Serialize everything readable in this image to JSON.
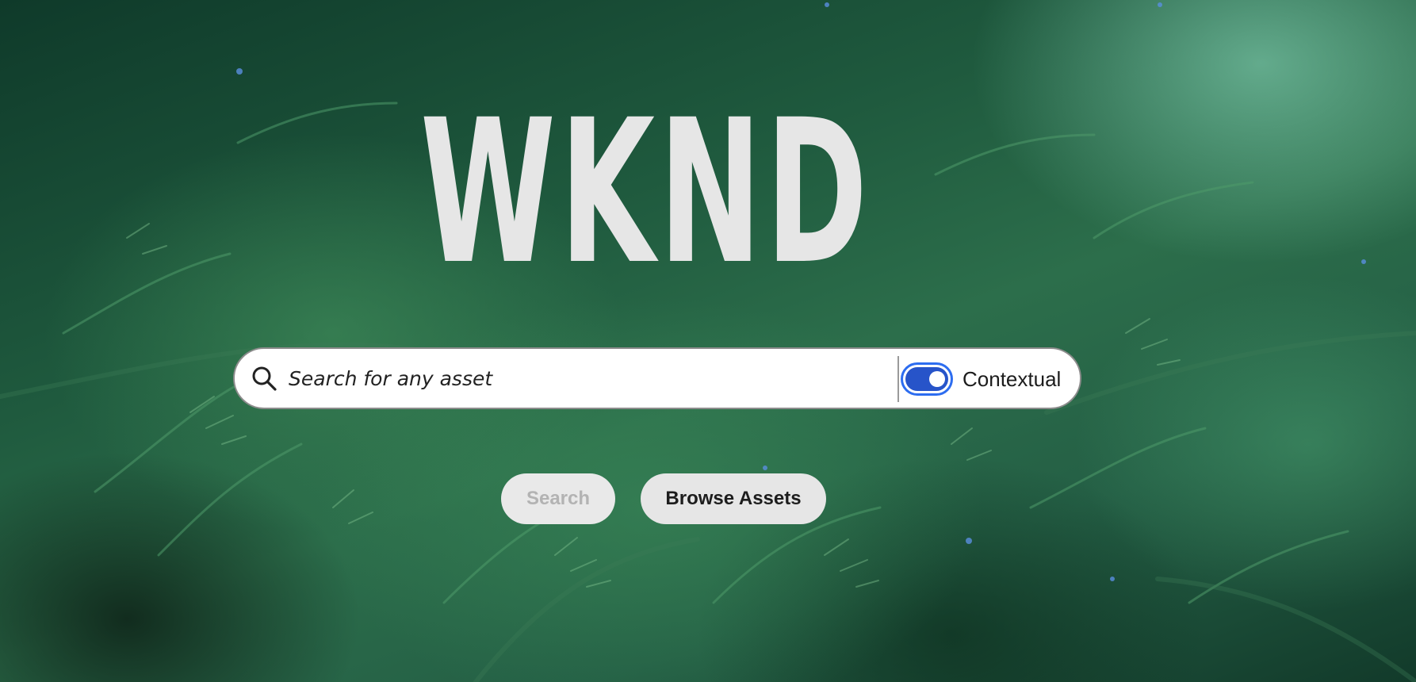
{
  "app": {
    "logo_text": "WKND"
  },
  "search": {
    "placeholder": "Search for any asset",
    "value": "",
    "contextual_toggle": {
      "label": "Contextual",
      "on": true
    }
  },
  "actions": {
    "search_label": "Search",
    "search_disabled": true,
    "browse_label": "Browse Assets"
  },
  "colors": {
    "toggle_accent": "#2d6df0",
    "toggle_track": "#2754c9",
    "button_bg": "#e6e6e6",
    "disabled_text": "#b3b3b3",
    "logo_text": "#e6e6e6"
  },
  "icons": {
    "search": "search-icon"
  }
}
